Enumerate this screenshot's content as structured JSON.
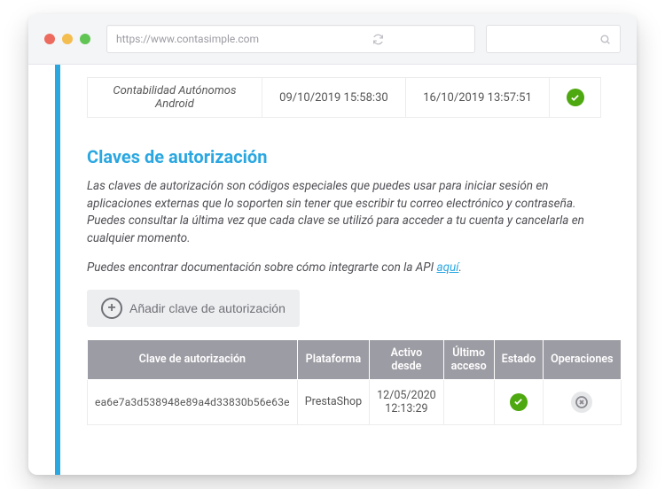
{
  "chrome": {
    "url": "https://www.contasimple.com"
  },
  "topRow": {
    "app": "Contabilidad Autónomos Android",
    "since": "09/10/2019 15:58:30",
    "last": "16/10/2019 13:57:51"
  },
  "section": {
    "title": "Claves de autorización",
    "p1": "Las claves de autorización son códigos especiales que puedes usar para iniciar sesión en aplicaciones externas que lo soporten sin tener que escribir tu correo electrónico y contraseña. Puedes consultar la última vez que cada clave se utilizó para acceder a tu cuenta y cancelarla en cualquier momento.",
    "p2a": "Puedes encontrar documentación sobre cómo integrarte con la API ",
    "p2link": "aquí",
    "p2b": ".",
    "addBtn": "Añadir clave de autorización"
  },
  "keysTable": {
    "headers": {
      "key": "Clave de autorización",
      "platform": "Plataforma",
      "active": "Activo desde",
      "last": "Último acceso",
      "state": "Estado",
      "ops": "Operaciones"
    },
    "row": {
      "key": "ea6e7a3d538948e89a4d33830b56e63e",
      "platform": "PrestaShop",
      "active": "12/05/2020 12:13:29",
      "last": ""
    }
  }
}
